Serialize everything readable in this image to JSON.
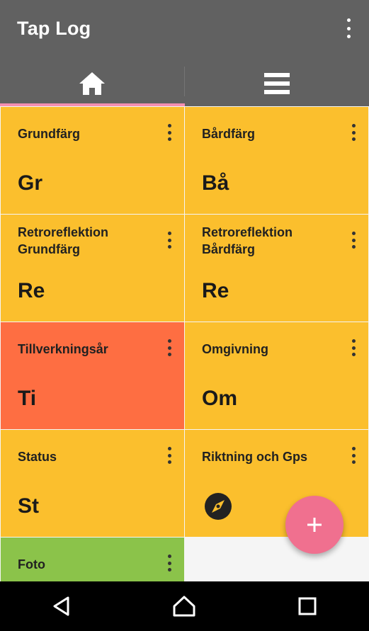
{
  "app": {
    "title": "Tap Log"
  },
  "tabs": [
    {
      "icon": "home-icon",
      "selected": true
    },
    {
      "icon": "list-icon",
      "selected": false
    }
  ],
  "tiles": [
    {
      "title": "Grundfärg",
      "abbr": "Gr",
      "color": "#fbbf2d"
    },
    {
      "title": "Bårdfärg",
      "abbr": "Bå",
      "color": "#fbbf2d"
    },
    {
      "title": "Retroreflektion Grundfärg",
      "abbr": "Re",
      "color": "#fbbf2d"
    },
    {
      "title": "Retroreflektion Bårdfärg",
      "abbr": "Re",
      "color": "#fbbf2d"
    },
    {
      "title": "Tillverkningsår",
      "abbr": "Ti",
      "color": "#fe6e42"
    },
    {
      "title": "Omgivning",
      "abbr": "Om",
      "color": "#fbbf2d"
    },
    {
      "title": "Status",
      "abbr": "St",
      "color": "#fbbf2d"
    },
    {
      "title": "Riktning och Gps",
      "abbr": "",
      "icon": "compass-icon",
      "color": "#fbbf2d"
    },
    {
      "title": "Foto",
      "abbr": "",
      "color": "#8bc34a"
    }
  ],
  "fab": {
    "icon": "plus-icon",
    "color": "#f0708f"
  },
  "colors": {
    "appbar": "#616161",
    "accent": "#f48fb1"
  }
}
